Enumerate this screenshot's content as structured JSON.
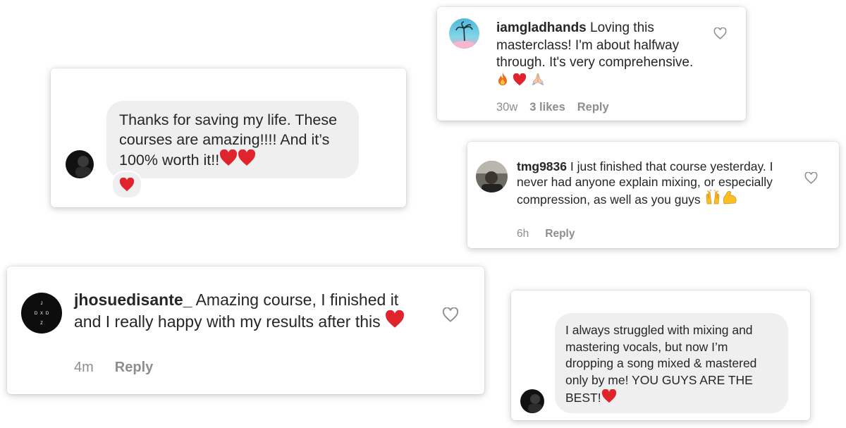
{
  "comments": [
    {
      "text": "Thanks for saving my life. These courses are amazing!!!! And it’s 100% worth it!!",
      "reaction": "heart-emoji"
    },
    {
      "username": "iamgladhands",
      "text": "Loving this masterclass! I'm about halfway through. It's very comprehensive.",
      "time": "30w",
      "likes": "3 likes",
      "reply": "Reply"
    },
    {
      "username": "tmg9836",
      "text": "I just finished that course yesterday. I never had anyone explain mixing, or especially compression, as well as you guys",
      "time": "6h",
      "reply": "Reply"
    },
    {
      "username": "jhosuedisante_",
      "text": "Amazing course,  I finished it and I really happy with my results after this",
      "time": "4m",
      "reply": "Reply",
      "avatar_letters": [
        "J",
        "D",
        "X",
        "D",
        "Z"
      ]
    },
    {
      "text": "I always struggled with mixing and mastering vocals, but now I’m dropping a song mixed & mastered only by me! YOU GUYS ARE THE BEST!"
    }
  ],
  "colors": {
    "bubble": "#efefef",
    "meta": "#8e8e8e",
    "heart": "#e0242e"
  }
}
